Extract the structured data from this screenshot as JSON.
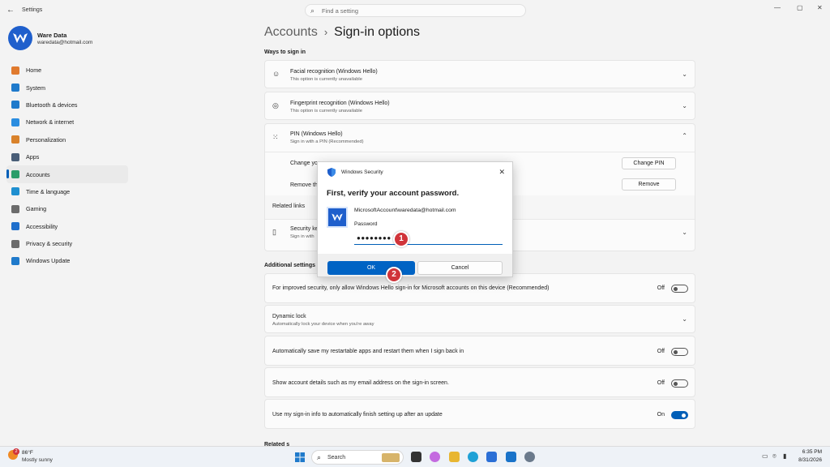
{
  "window": {
    "title": "Settings",
    "search_placeholder": "Find a setting"
  },
  "profile": {
    "name": "Ware Data",
    "email": "waredata@hotmail.com"
  },
  "sidebar": {
    "items": [
      {
        "label": "Home",
        "color": "#e07a2e"
      },
      {
        "label": "System",
        "color": "#1f7acb"
      },
      {
        "label": "Bluetooth & devices",
        "color": "#1f7acb"
      },
      {
        "label": "Network & internet",
        "color": "#2a8de0"
      },
      {
        "label": "Personalization",
        "color": "#d9822b"
      },
      {
        "label": "Apps",
        "color": "#4a5e78"
      },
      {
        "label": "Accounts",
        "color": "#2a9d6a"
      },
      {
        "label": "Time & language",
        "color": "#1f8fd0"
      },
      {
        "label": "Gaming",
        "color": "#6b6b6b"
      },
      {
        "label": "Accessibility",
        "color": "#1f6fcc"
      },
      {
        "label": "Privacy & security",
        "color": "#6b6b6b"
      },
      {
        "label": "Windows Update",
        "color": "#1f7acb"
      }
    ],
    "active_index": 6
  },
  "breadcrumb": {
    "parent": "Accounts",
    "separator": "›",
    "current": "Sign-in options"
  },
  "ways": {
    "heading": "Ways to sign in",
    "facial": {
      "title": "Facial recognition (Windows Hello)",
      "subtitle": "This option is currently unavailable"
    },
    "fingerprint": {
      "title": "Fingerprint recognition (Windows Hello)",
      "subtitle": "This option is currently unavailable"
    },
    "pin": {
      "title": "PIN (Windows Hello)",
      "subtitle": "Sign in with a PIN (Recommended)"
    },
    "change_row": "Change yo",
    "change_pin_btn": "Change PIN",
    "remove_row": "Remove th",
    "remove_btn": "Remove",
    "related_links": "Related links",
    "security_key": {
      "title": "Security ke",
      "subtitle": "Sign in with"
    }
  },
  "additional": {
    "heading": "Additional settings",
    "rows": [
      {
        "text": "For improved security, only allow Windows Hello sign-in for Microsoft accounts on this device (Recommended)",
        "state": "Off"
      },
      {
        "text": "Automatically save my restartable apps and restart them when I sign back in",
        "state": "Off"
      },
      {
        "text": "Show account details such as my email address on the sign-in screen.",
        "state": "Off"
      },
      {
        "text": "Use my sign-in info to automatically finish setting up after an update",
        "state": "On"
      }
    ],
    "dynamic_lock": {
      "title": "Dynamic lock",
      "subtitle": "Automatically lock your device when you're away"
    },
    "cut_heading": "Related s"
  },
  "dialog": {
    "title": "Windows Security",
    "heading": "First, verify your account password.",
    "account": "MicrosoftAccount\\waredata@hotmail.com",
    "password_label": "Password",
    "password_mask": "●●●●●●●●",
    "ok": "OK",
    "cancel": "Cancel",
    "step1": "1",
    "step2": "2"
  },
  "taskbar": {
    "weather_temp": "86°F",
    "weather_desc": "Mostly sunny",
    "weather_badge": "2",
    "search_label": "Search",
    "time": "6:35 PM",
    "date": "8/31/2026"
  },
  "colors": {
    "accent": "#005fb8",
    "brand": "#1f5fcc",
    "step_badge": "#d0343a"
  }
}
